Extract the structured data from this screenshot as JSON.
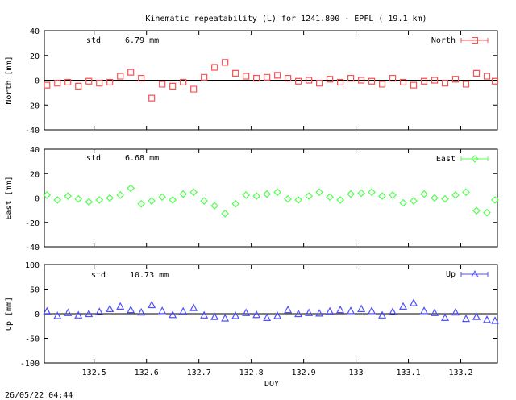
{
  "title": "Kinematic repeatability (L) for 1241.800 - EPFL  ( 19.1 km)",
  "timestamp": "26/05/22 04:44",
  "xlabel": "DOY",
  "x_ticks": [
    "132.5",
    "132.6",
    "132.7",
    "132.8",
    "132.9",
    "133",
    "133.1",
    "133.2"
  ],
  "chart_data": [
    {
      "type": "scatter",
      "ylabel": "North [mm]",
      "ylim": [
        -50,
        50
      ],
      "y_ticks": [
        "40",
        "20",
        "0",
        "-20",
        "-40"
      ],
      "xlim": [
        132.405,
        133.27
      ],
      "legend": "North",
      "legend_position": "top-right",
      "marker": "square",
      "color": "#ff5050",
      "std_label": "std",
      "std_value": "6.79 mm",
      "x": [
        132.41,
        132.43,
        132.45,
        132.47,
        132.49,
        132.51,
        132.53,
        132.55,
        132.57,
        132.59,
        132.61,
        132.63,
        132.65,
        132.67,
        132.69,
        132.71,
        132.73,
        132.75,
        132.77,
        132.79,
        132.81,
        132.83,
        132.85,
        132.87,
        132.89,
        132.91,
        132.93,
        132.95,
        132.97,
        132.99,
        133.01,
        133.03,
        133.05,
        133.07,
        133.09,
        133.11,
        133.13,
        133.15,
        133.17,
        133.19,
        133.21,
        133.23,
        133.25,
        133.27
      ],
      "values": [
        -5,
        -3,
        -2,
        -6,
        -1,
        -3,
        -2,
        4,
        8,
        2,
        -18,
        -4,
        -6,
        -2,
        -9,
        3,
        13,
        18,
        7,
        4,
        2,
        3,
        5,
        2,
        -1,
        0,
        -3,
        1,
        -2,
        2,
        0,
        -1,
        -4,
        2,
        -2,
        -5,
        -1,
        0,
        -3,
        1,
        -4,
        7,
        4,
        -1
      ]
    },
    {
      "type": "scatter",
      "ylabel": "East [mm]",
      "ylim": [
        -50,
        50
      ],
      "y_ticks": [
        "40",
        "20",
        "0",
        "-20",
        "-40"
      ],
      "xlim": [
        132.405,
        133.27
      ],
      "legend": "East",
      "legend_position": "top-right",
      "marker": "diamond",
      "color": "#50ff50",
      "std_label": "std",
      "std_value": "6.68 mm",
      "x": [
        132.41,
        132.43,
        132.45,
        132.47,
        132.49,
        132.51,
        132.53,
        132.55,
        132.57,
        132.59,
        132.61,
        132.63,
        132.65,
        132.67,
        132.69,
        132.71,
        132.73,
        132.75,
        132.77,
        132.79,
        132.81,
        132.83,
        132.85,
        132.87,
        132.89,
        132.91,
        132.93,
        132.95,
        132.97,
        132.99,
        133.01,
        133.03,
        133.05,
        133.07,
        133.09,
        133.11,
        133.13,
        133.15,
        133.17,
        133.19,
        133.21,
        133.23,
        133.25,
        133.27
      ],
      "values": [
        3,
        -2,
        2,
        -1,
        -4,
        -2,
        0,
        3,
        10,
        -6,
        -3,
        1,
        -2,
        4,
        6,
        -3,
        -8,
        -16,
        -6,
        3,
        2,
        4,
        6,
        -1,
        -2,
        2,
        6,
        1,
        -2,
        4,
        5,
        6,
        2,
        3,
        -5,
        -3,
        4,
        0,
        -1,
        3,
        6,
        -13,
        -15,
        -2
      ]
    },
    {
      "type": "scatter",
      "ylabel": "Up [mm]",
      "ylim": [
        -100,
        100
      ],
      "y_ticks": [
        "100",
        "50",
        "0",
        "-50",
        "-100"
      ],
      "xlim": [
        132.405,
        133.27
      ],
      "legend": "Up",
      "legend_position": "top-right",
      "marker": "triangle",
      "color": "#5050ff",
      "std_label": "std",
      "std_value": "10.73 mm",
      "x": [
        132.41,
        132.43,
        132.45,
        132.47,
        132.49,
        132.51,
        132.53,
        132.55,
        132.57,
        132.59,
        132.61,
        132.63,
        132.65,
        132.67,
        132.69,
        132.71,
        132.73,
        132.75,
        132.77,
        132.79,
        132.81,
        132.83,
        132.85,
        132.87,
        132.89,
        132.91,
        132.93,
        132.95,
        132.97,
        132.99,
        133.01,
        133.03,
        133.05,
        133.07,
        133.09,
        133.11,
        133.13,
        133.15,
        133.17,
        133.19,
        133.21,
        133.23,
        133.25,
        133.27
      ],
      "values": [
        5,
        -4,
        2,
        -3,
        0,
        4,
        10,
        15,
        8,
        3,
        18,
        6,
        -2,
        5,
        12,
        -3,
        -6,
        -9,
        -4,
        2,
        -2,
        -8,
        -4,
        8,
        0,
        2,
        1,
        5,
        8,
        6,
        10,
        6,
        -3,
        4,
        15,
        22,
        6,
        2,
        -8,
        3,
        -10,
        -6,
        -12,
        -14
      ]
    }
  ]
}
